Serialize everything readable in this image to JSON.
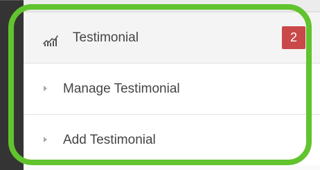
{
  "menu": {
    "title": "Testimonial",
    "icon": "analytics-chart-icon",
    "badge_count": "2",
    "items": [
      {
        "label": "Manage Testimonial",
        "icon": "caret-right-icon"
      },
      {
        "label": "Add Testimonial",
        "icon": "caret-right-icon"
      }
    ]
  },
  "colors": {
    "badge": "#c9484a",
    "highlight": "#61c32d",
    "text": "#444444",
    "sidebar_edge": "#343434"
  }
}
